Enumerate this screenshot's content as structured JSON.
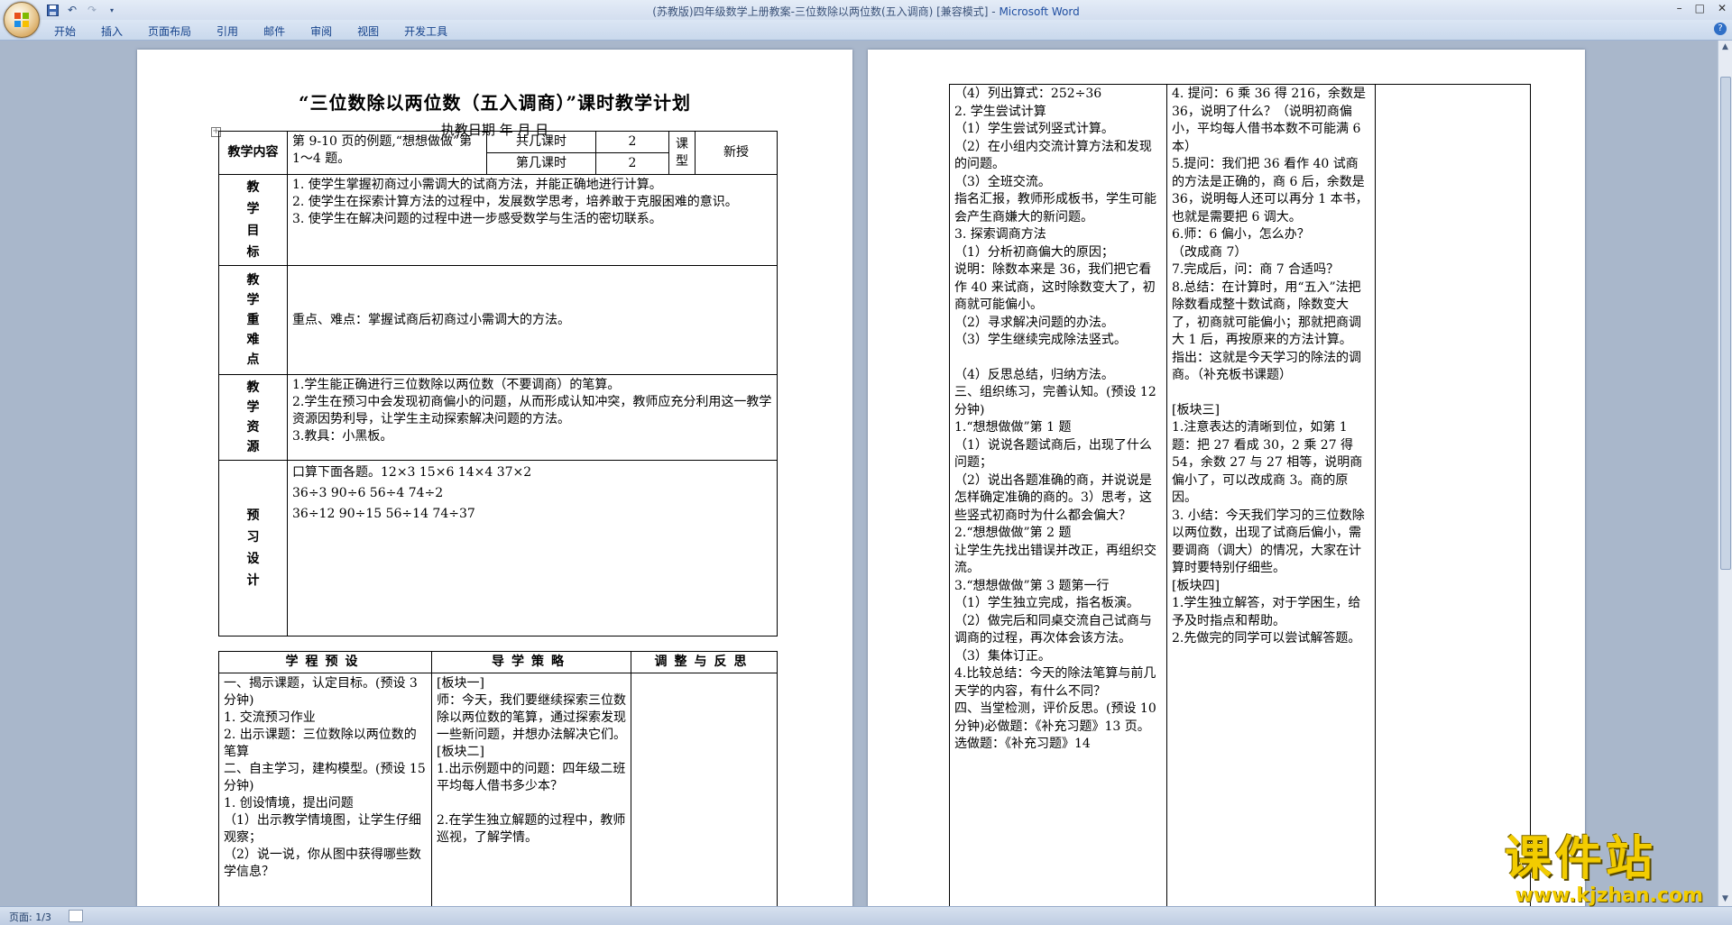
{
  "window": {
    "title": "(苏教版)四年级数学上册教案-三位数除以两位数(五入调商) [兼容模式] - ",
    "app_name": "Microsoft Word",
    "controls": [
      "–",
      "□",
      "✕"
    ]
  },
  "ribbon": {
    "tabs": [
      "开始",
      "插入",
      "页面布局",
      "引用",
      "邮件",
      "审阅",
      "视图",
      "开发工具"
    ]
  },
  "status": {
    "page": "页面: 1/3"
  },
  "watermark": {
    "cn": "课件站",
    "url": "www.kjzhan.com"
  },
  "page1": {
    "title": "“三位数除以两位数（五入调商）”课时教学计划",
    "date_line": "执教日期    年   月    日",
    "content_label": "教学内容",
    "content_text": "第 9-10 页的例题,“想想做做”第 1～4 题。",
    "total_hours_label": "共几课时",
    "total_hours_value": "2",
    "current_hour_label": "第几课时",
    "current_hour_value": "2",
    "lesson_type_label": "课型",
    "lesson_type_value": "新授",
    "goals_label": "教学目标",
    "goals": [
      "1.  使学生掌握初商过小需调大的试商方法，并能正确地进行计算。",
      "2.  使学生在探索计算方法的过程中，发展数学思考，培养敢于克服困难的意识。",
      "3.  使学生在解决问题的过程中进一步感受数学与生活的密切联系。"
    ],
    "key_label": "教学重难点",
    "key_text": "重点、难点：掌握试商后初商过小需调大的方法。",
    "resources_label": "教学资源",
    "resources": [
      "1.学生能正确进行三位数除以两位数（不要调商）的笔算。",
      "2.学生在预习中会发现初商偏小的问题，从而形成认知冲突，教师应充分利用这一教学资源因势利导，让学生主动探索解决问题的方法。",
      "3.教具：小黑板。"
    ],
    "preview_label": "预习设计",
    "preview": [
      "口算下面各题。12×3   15×6   14×4     37×2",
      "  36÷3   90÷6     56÷4    74÷2",
      "36÷12   90÷15   56÷14   74÷37"
    ],
    "col_headers": [
      "学程预设",
      "导学策略",
      "调整与反思"
    ],
    "col1": [
      "一、揭示课题，认定目标。(预设 3 分钟)",
      "1. 交流预习作业",
      "2. 出示课题：三位数除以两位数的笔算",
      "二、自主学习，建构模型。(预设 15 分钟)",
      "1. 创设情境，提出问题",
      "（1）出示教学情境图，让学生仔细观察；",
      "（2）说一说，你从图中获得哪些数学信息？"
    ],
    "col2": [
      "[板块一]",
      "师：今天，我们要继续探索三位数除以两位数的笔算，通过探索发现一些新问题，并想办法解决它们。",
      "[板块二]",
      "1.出示例题中的问题：四年级二班平均每人借书多少本？",
      "",
      "2.在学生独立解题的过程中，教师巡视，了解学情。"
    ]
  },
  "page2": {
    "col1": [
      "（4）列出算式：252÷36",
      "2. 学生尝试计算",
      "（1）学生尝试列竖式计算。",
      "（2）在小组内交流计算方法和发现的问题。",
      "（3）全班交流。",
      "指名汇报，教师形成板书，学生可能会产生商嫌大的新问题。",
      "3. 探索调商方法",
      "（1）分析初商偏大的原因；",
      "说明：除数本来是 36，我们把它看作 40 来试商，这时除数变大了，初商就可能偏小。",
      "（2）寻求解决问题的办法。",
      "（3）学生继续完成除法竖式。",
      "",
      "（4）反思总结，归纳方法。",
      "三、组织练习，完善认知。(预设 12 分钟)",
      "1.“想想做做”第 1 题",
      "（1）说说各题试商后，出现了什么问题；",
      "（2）说出各题准确的商，并说说是怎样确定准确的商的。3）思考，这些竖式初商时为什么都会偏大？",
      "2.“想想做做”第 2 题",
      "让学生先找出错误并改正，再组织交流。",
      "3.“想想做做”第 3 题第一行",
      "（1）学生独立完成，指名板演。",
      "（2）做完后和同桌交流自己试商与调商的过程，再次体会该方法。",
      "（3）集体订正。",
      "4.比较总结：今天的除法笔算与前几天学的内容，有什么不同？",
      "四、当堂检测，评价反思。(预设 10 分钟)必做题：《补充习题》13 页。选做题：《补充习题》14"
    ],
    "col2": [
      "4. 提问：6 乘 36 得 216，余数是 36，说明了什么？（说明初商偏小，平均每人借书本数不可能满 6 本）",
      "5.提问：我们把 36 看作 40 试商的方法是正确的，商 6 后，余数是 36，说明每人还可以再分 1 本书，也就是需要把 6 调大。",
      "6.师：6 偏小，怎么办？",
      "（改成商 7）",
      "7.完成后，问：商 7 合适吗？",
      "8.总结：在计算时，用“五入”法把除数看成整十数试商，除数变大了，初商就可能偏小；那就把商调大 1 后，再按原来的方法计算。",
      "指出：这就是今天学习的除法的调商。（补充板书课题）",
      "",
      "[板块三]",
      "1.注意表达的清晰到位，如第 1 题：把 27 看成 30，2 乘 27 得 54，余数 27 与 27 相等，说明商偏小了，可以改成商 3。商的原因。",
      "3. 小结：今天我们学习的三位数除以两位数，出现了试商后偏小，需要调商（调大）的情况，大家在计算时要特别仔细些。",
      "[板块四]",
      "1.学生独立解答，对于学困生，给予及时指点和帮助。",
      "2.先做完的同学可以尝试解答题。"
    ]
  }
}
